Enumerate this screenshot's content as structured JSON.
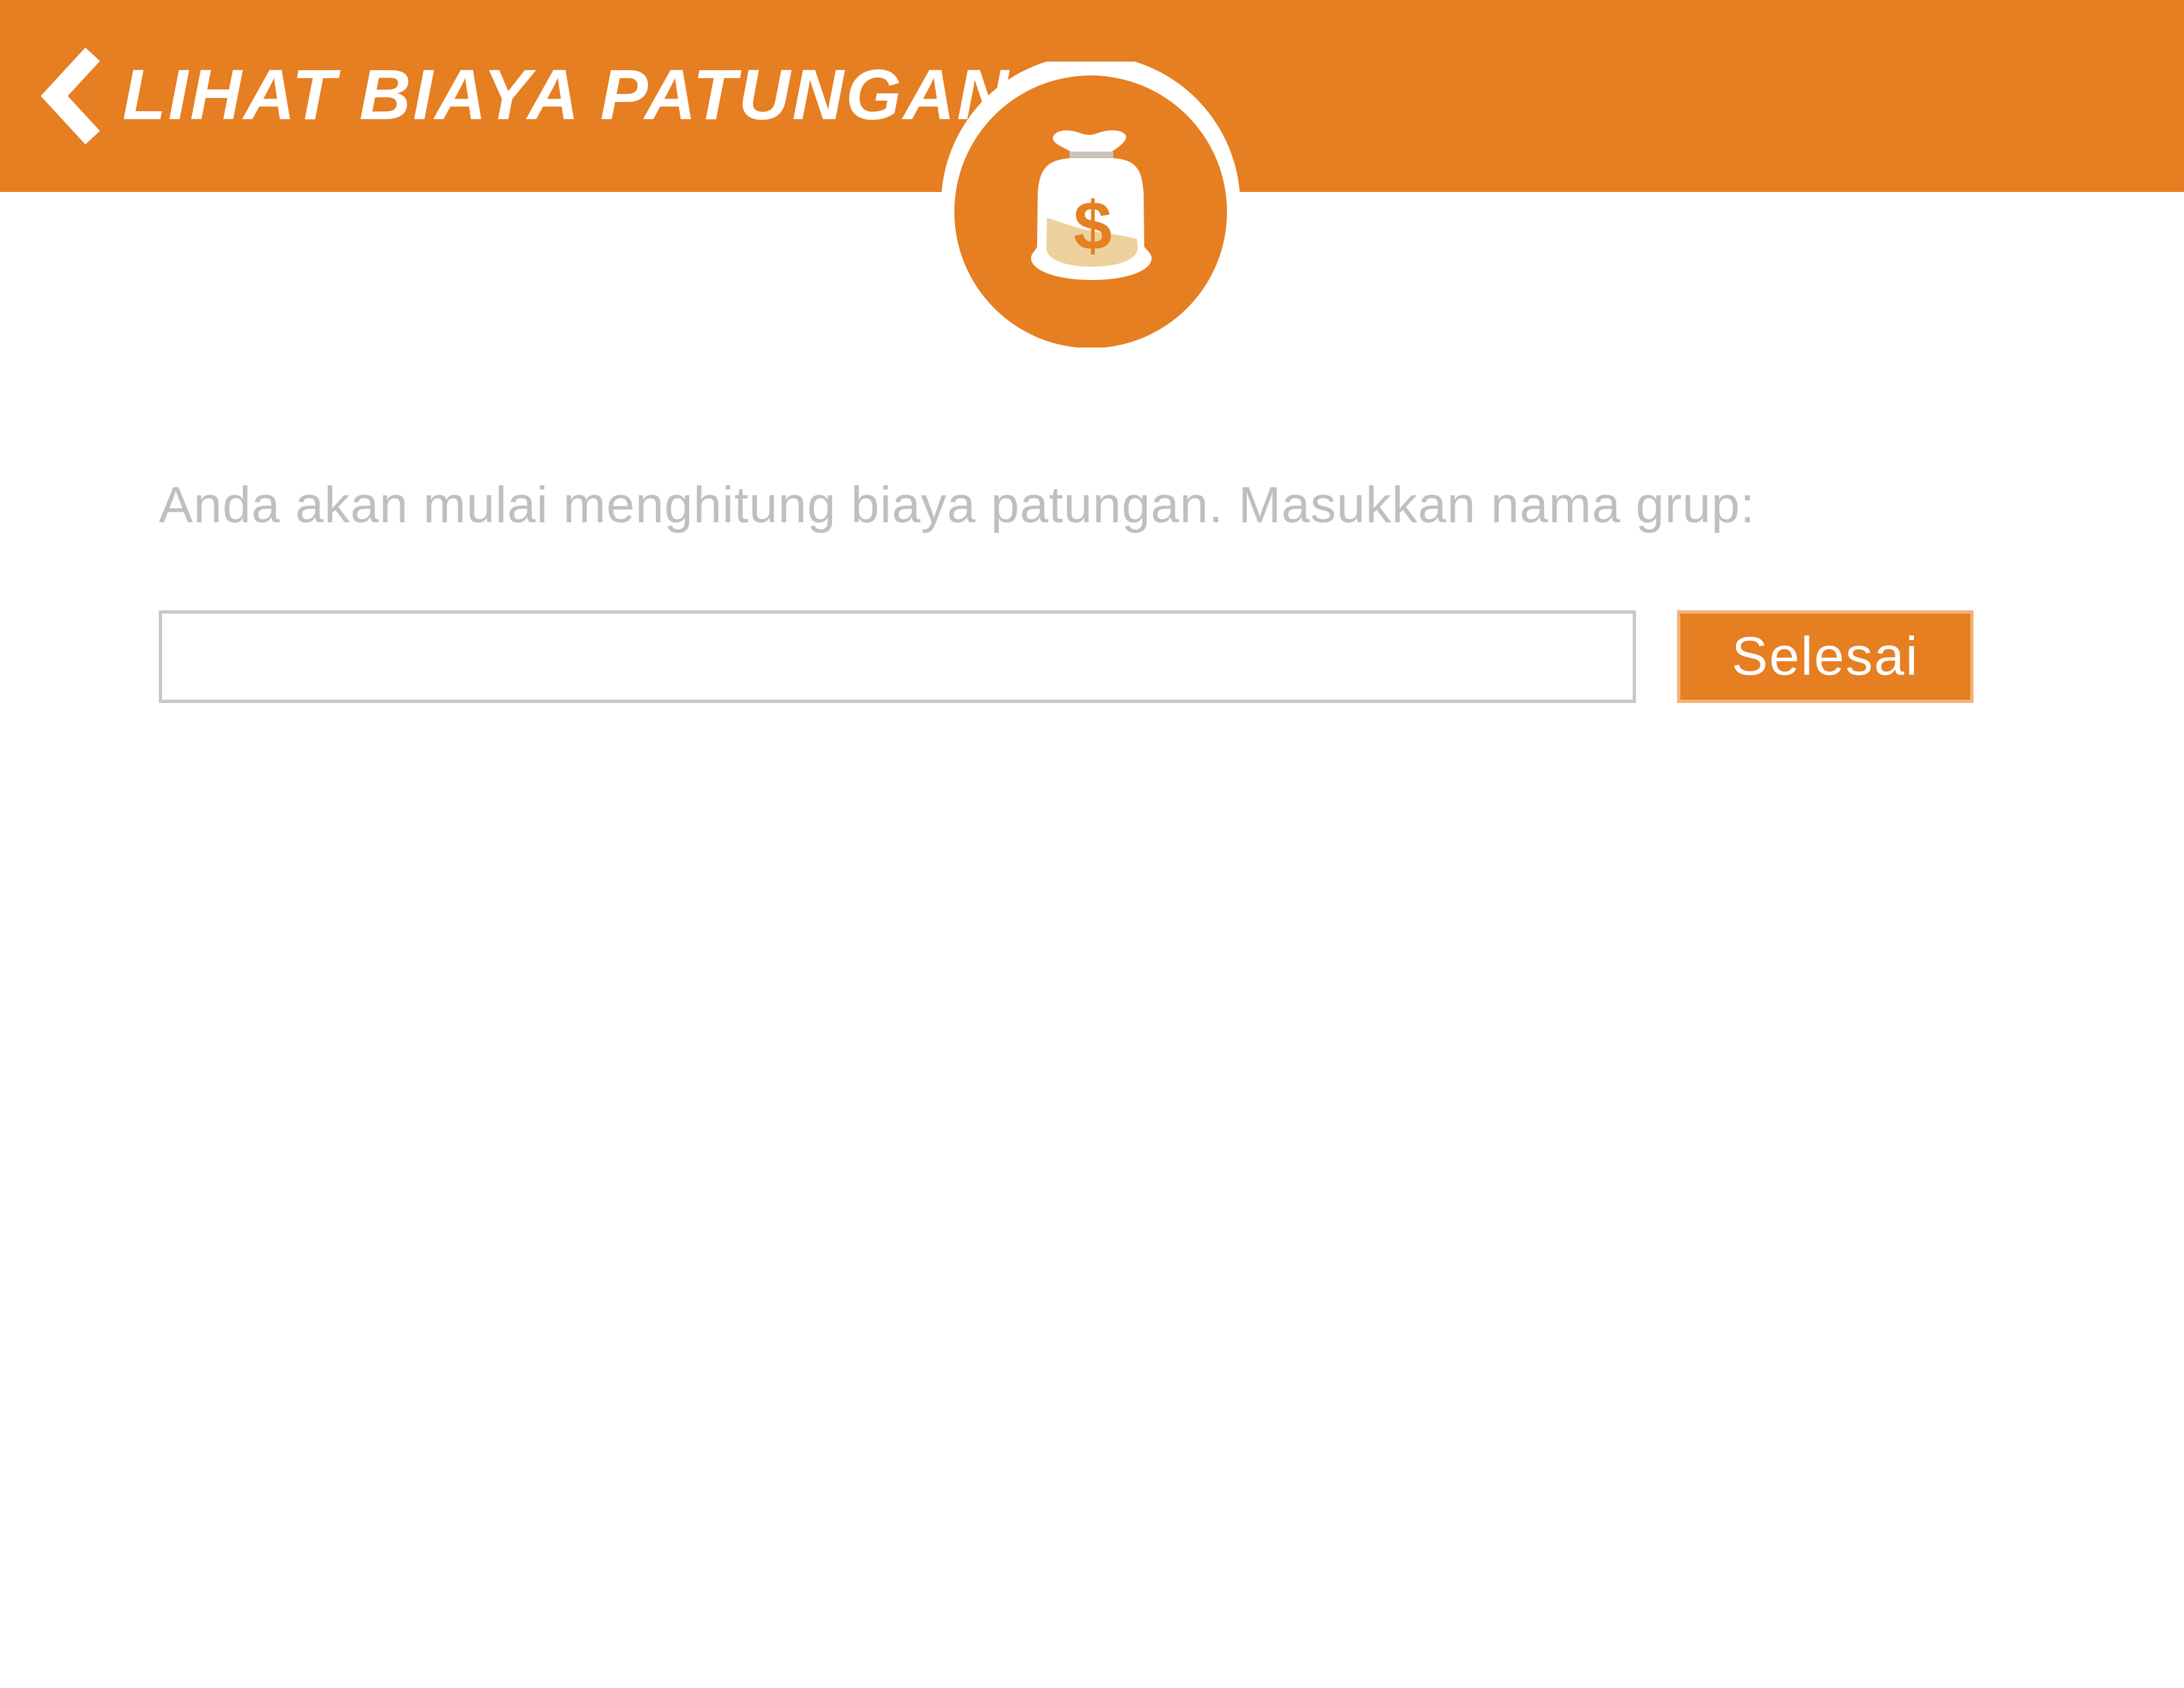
{
  "header": {
    "back_icon": "chevron-left-icon",
    "title": "LIHAT BIAYA PATUNGAN",
    "badge_icon": "money-bag-icon",
    "background_color": "#E67E22"
  },
  "main": {
    "prompt": "Anda akan mulai menghitung biaya patungan. Masukkan nama grup:",
    "group_name_input": {
      "value": "",
      "placeholder": ""
    },
    "done_button_label": "Selesai"
  },
  "colors": {
    "accent": "#E67E22",
    "prompt_text": "#BFBFBF",
    "input_border": "#C8C8C8",
    "button_border": "#F2B27A",
    "bag_fill": "#EDD19C"
  }
}
